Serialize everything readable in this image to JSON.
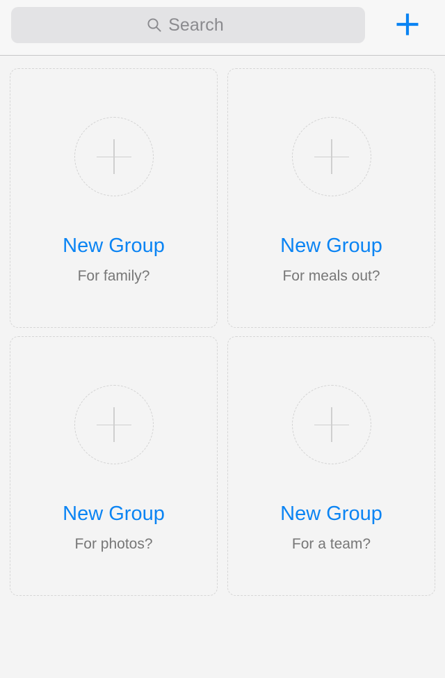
{
  "header": {
    "search": {
      "placeholder": "Search",
      "value": "",
      "icon": "search-icon"
    },
    "add_button": {
      "icon": "plus-icon",
      "label": "",
      "color": "#0B84F3"
    }
  },
  "colors": {
    "accent_blue": "#0B84F3",
    "page_background": "#F4F4F4",
    "header_background": "#F7F7F7",
    "search_background": "#E3E3E5",
    "placeholder_text": "#8A8A8E",
    "subtitle_text": "#777777",
    "dashed_border": "#D6D6D6",
    "separator": "#C6C6C8"
  },
  "grid": {
    "cards": [
      {
        "icon": "plus-in-dashed-circle-icon",
        "title": "New Group",
        "subtitle": "For family?"
      },
      {
        "icon": "plus-in-dashed-circle-icon",
        "title": "New Group",
        "subtitle": "For meals out?"
      },
      {
        "icon": "plus-in-dashed-circle-icon",
        "title": "New Group",
        "subtitle": "For photos?"
      },
      {
        "icon": "plus-in-dashed-circle-icon",
        "title": "New Group",
        "subtitle": "For a team?"
      }
    ]
  }
}
